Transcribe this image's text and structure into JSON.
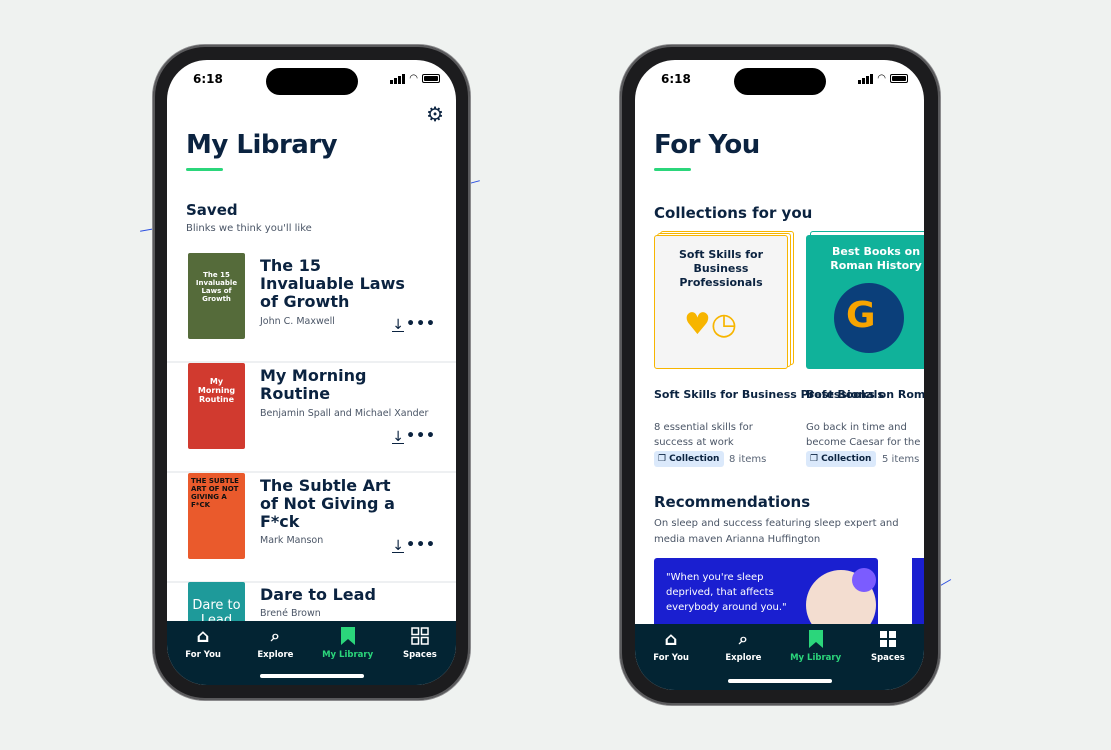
{
  "status": {
    "time": "6:18"
  },
  "library": {
    "title": "My Library",
    "saved_heading": "Saved",
    "saved_sub": "Blinks we think you'll like",
    "books": [
      {
        "title": "The 15 Invaluable Laws of Growth",
        "author": "John C. Maxwell",
        "cover_text": "The 15 Invaluable Laws of Growth",
        "cover_color": "#556b3a"
      },
      {
        "title": "My Morning Routine",
        "author": "Benjamin Spall and Michael Xander",
        "cover_text": "My Morning Routine",
        "cover_color": "#d13a2f"
      },
      {
        "title": "The Subtle Art of Not Giving a F*ck",
        "author": "Mark Manson",
        "cover_text": "THE SUBTLE ART OF NOT GIVING A F*CK",
        "cover_color": "#ea5a2c"
      },
      {
        "title": "Dare to Lead",
        "author": "Brené Brown",
        "cover_text": "Dare to Lead",
        "cover_color": "#1e9a9a"
      }
    ]
  },
  "foryou": {
    "title": "For You",
    "collections_heading": "Collections for you",
    "collections": [
      {
        "cover_title": "Soft Skills for Business Professionals",
        "title": "Soft Skills for Business Professionals",
        "desc": "8 essential skills for success at work",
        "badge": "Collection",
        "count": "8 items",
        "color": "#f7b500"
      },
      {
        "cover_title": "Best Books on Roman History",
        "title": "Best Books on Roman History",
        "desc": "Go back in time and become Caesar for the day",
        "badge": "Collection",
        "count": "5 items",
        "color": "#10b29a"
      }
    ],
    "rec_heading": "Recommendations",
    "rec_desc": "On sleep and success featuring sleep expert and media maven Arianna Huffington",
    "quote": "\"When you're sleep deprived, that affects everybody around you.\""
  },
  "nav": {
    "items": [
      "For You",
      "Explore",
      "My Library",
      "Spaces"
    ],
    "active_color": "#2bd67b"
  }
}
